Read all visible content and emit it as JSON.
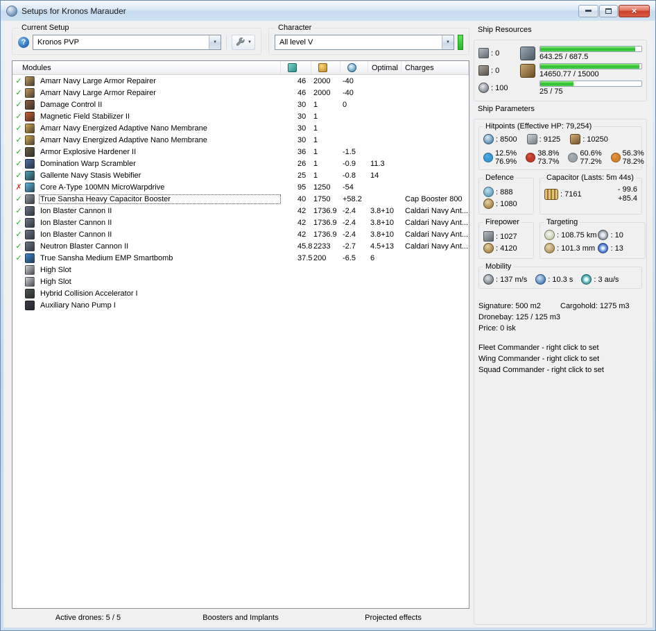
{
  "window": {
    "title": "Setups for Kronos Marauder"
  },
  "toolbar": {
    "current_setup_label": "Current Setup",
    "current_setup_value": "Kronos PVP",
    "character_label": "Character",
    "character_value": "All level V"
  },
  "modules": {
    "header": {
      "name": "Modules",
      "optimal": "Optimal",
      "charges": "Charges"
    },
    "rows": [
      {
        "status": "ok",
        "icon": "armor-repairer-icon",
        "color": "#b89058",
        "name": "Amarr Navy Large Armor Repairer",
        "cpu": "46",
        "pg": "2000",
        "cap": "-40",
        "optimal": "",
        "charges": ""
      },
      {
        "status": "ok",
        "icon": "armor-repairer-icon",
        "color": "#b89058",
        "name": "Amarr Navy Large Armor Repairer",
        "cpu": "46",
        "pg": "2000",
        "cap": "-40",
        "optimal": "",
        "charges": ""
      },
      {
        "status": "ok",
        "icon": "damage-control-icon",
        "color": "#8a5a38",
        "name": "Damage Control II",
        "cpu": "30",
        "pg": "1",
        "cap": "0",
        "optimal": "",
        "charges": ""
      },
      {
        "status": "ok",
        "icon": "magnetic-field-stabilizer-icon",
        "color": "#c05a30",
        "name": "Magnetic Field Stabilizer II",
        "cpu": "30",
        "pg": "1",
        "cap": "",
        "optimal": "",
        "charges": ""
      },
      {
        "status": "ok",
        "icon": "adaptive-nano-membrane-icon",
        "color": "#c8a050",
        "name": "Amarr Navy Energized Adaptive Nano Membrane",
        "cpu": "30",
        "pg": "1",
        "cap": "",
        "optimal": "",
        "charges": ""
      },
      {
        "status": "ok",
        "icon": "adaptive-nano-membrane-icon",
        "color": "#c8a050",
        "name": "Amarr Navy Energized Adaptive Nano Membrane",
        "cpu": "30",
        "pg": "1",
        "cap": "",
        "optimal": "",
        "charges": ""
      },
      {
        "status": "ok",
        "icon": "armor-hardener-icon",
        "color": "#6a5a40",
        "name": "Armor Explosive Hardener II",
        "cpu": "36",
        "pg": "1",
        "cap": "-1.5",
        "optimal": "",
        "charges": ""
      },
      {
        "status": "ok",
        "icon": "warp-scrambler-icon",
        "color": "#4a6a9a",
        "name": "Domination Warp Scrambler",
        "cpu": "26",
        "pg": "1",
        "cap": "-0.9",
        "optimal": "11.3",
        "charges": ""
      },
      {
        "status": "ok",
        "icon": "stasis-webifier-icon",
        "color": "#4a98a8",
        "name": "Gallente Navy Stasis Webifier",
        "cpu": "25",
        "pg": "1",
        "cap": "-0.8",
        "optimal": "14",
        "charges": ""
      },
      {
        "status": "error",
        "icon": "microwarpdrive-icon",
        "color": "#58b0d8",
        "name": "Core A-Type 100MN MicroWarpdrive",
        "cpu": "95",
        "pg": "1250",
        "cap": "-54",
        "optimal": "",
        "charges": ""
      },
      {
        "status": "ok",
        "selected": true,
        "icon": "capacitor-booster-icon",
        "color": "#8a9098",
        "name": "True Sansha Heavy Capacitor Booster",
        "cpu": "40",
        "pg": "1750",
        "cap": "+58.2",
        "optimal": "",
        "charges": "Cap Booster 800"
      },
      {
        "status": "ok",
        "icon": "blaster-icon",
        "color": "#687080",
        "name": "Ion Blaster Cannon II",
        "cpu": "42",
        "pg": "1736.9",
        "cap": "-2.4",
        "optimal": "3.8+10",
        "charges": "Caldari Navy Ant..."
      },
      {
        "status": "ok",
        "icon": "blaster-icon",
        "color": "#687080",
        "name": "Ion Blaster Cannon II",
        "cpu": "42",
        "pg": "1736.9",
        "cap": "-2.4",
        "optimal": "3.8+10",
        "charges": "Caldari Navy Ant..."
      },
      {
        "status": "ok",
        "icon": "blaster-icon",
        "color": "#687080",
        "name": "Ion Blaster Cannon II",
        "cpu": "42",
        "pg": "1736.9",
        "cap": "-2.4",
        "optimal": "3.8+10",
        "charges": "Caldari Navy Ant..."
      },
      {
        "status": "ok",
        "icon": "blaster-icon",
        "color": "#687080",
        "name": "Neutron Blaster Cannon II",
        "cpu": "45.8",
        "pg": "2233",
        "cap": "-2.7",
        "optimal": "4.5+13",
        "charges": "Caldari Navy Ant..."
      },
      {
        "status": "ok",
        "icon": "smartbomb-icon",
        "color": "#3a80c8",
        "name": "True Sansha Medium EMP Smartbomb",
        "cpu": "37.5",
        "pg": "200",
        "cap": "-6.5",
        "optimal": "6",
        "charges": ""
      },
      {
        "status": "none",
        "icon": "empty-highslot-icon",
        "color": "#c0c4c8",
        "name": "High Slot",
        "cpu": "",
        "pg": "",
        "cap": "",
        "optimal": "",
        "charges": ""
      },
      {
        "status": "none",
        "icon": "empty-highslot-icon",
        "color": "#c0c4c8",
        "name": "High Slot",
        "cpu": "",
        "pg": "",
        "cap": "",
        "optimal": "",
        "charges": ""
      },
      {
        "status": "none",
        "icon": "rig-icon",
        "color": "#485048",
        "name": "Hybrid Collision Accelerator I",
        "cpu": "",
        "pg": "",
        "cap": "",
        "optimal": "",
        "charges": ""
      },
      {
        "status": "none",
        "icon": "rig-icon",
        "color": "#383844",
        "name": "Auxiliary Nano Pump I",
        "cpu": "",
        "pg": "",
        "cap": "",
        "optimal": "",
        "charges": ""
      }
    ]
  },
  "bottom_bar": {
    "active_drones": "Active drones: 5 / 5",
    "boosters": "Boosters and Implants",
    "projected": "Projected effects"
  },
  "ship_resources": {
    "title": "Ship Resources",
    "turrets": ": 0",
    "launchers": ": 0",
    "calibration": ": 100",
    "bars": [
      {
        "name": "cpu",
        "text": "643.25 / 687.5",
        "pct": 94
      },
      {
        "name": "powergrid",
        "text": "14650.77 / 15000",
        "pct": 98
      },
      {
        "name": "dronebay",
        "text": "25 / 75",
        "pct": 33
      }
    ]
  },
  "ship_parameters": {
    "title": "Ship Parameters",
    "hitpoints": {
      "title": "Hitpoints (Effective HP: 79,254)",
      "shield": ": 8500",
      "armor": ": 9125",
      "structure": ": 10250",
      "resists": [
        {
          "type": "em",
          "color": "#3a9ad8",
          "shield": "12.5%",
          "armor": "76.9%"
        },
        {
          "type": "thermal",
          "color": "#c23a28",
          "shield": "38.8%",
          "armor": "73.7%"
        },
        {
          "type": "kinetic",
          "color": "#9aa2aa",
          "shield": "60.6%",
          "armor": "77.2%"
        },
        {
          "type": "explosive",
          "color": "#d8822a",
          "shield": "56.3%",
          "armor": "78.2%"
        }
      ]
    },
    "defence": {
      "title": "Defence",
      "shield_recharge": ": 888",
      "armor_repair": ": 1080"
    },
    "capacitor": {
      "title": "Capacitor (Lasts: 5m 44s)",
      "amount": ": 7161",
      "drain": "- 99.6",
      "recharge": "+85.4"
    },
    "firepower": {
      "title": "Firepower",
      "dps": ": 1027",
      "volley": ": 4120"
    },
    "targeting": {
      "title": "Targeting",
      "range": ": 108.75 km",
      "max_targets": ": 10",
      "scan_resolution": ": 101.3 mm",
      "sensor_strength": ": 13"
    },
    "mobility": {
      "title": "Mobility",
      "speed": ": 137 m/s",
      "align": ": 10.3 s",
      "warp": ": 3 au/s"
    },
    "info": {
      "signature": "Signature: 500 m2",
      "cargohold": "Cargohold: 1275 m3",
      "dronebay": "Dronebay: 125 / 125 m3",
      "price": "Price: 0 isk",
      "fleet": "Fleet Commander - right click to set",
      "wing": "Wing Commander - right click to set",
      "squad": "Squad Commander - right click to set"
    }
  },
  "colors": {
    "bar_fill": "#3ed43e",
    "ok_check": "#2fa52f",
    "error_cross": "#c63a2a",
    "skill_level": "#2fd42f"
  }
}
